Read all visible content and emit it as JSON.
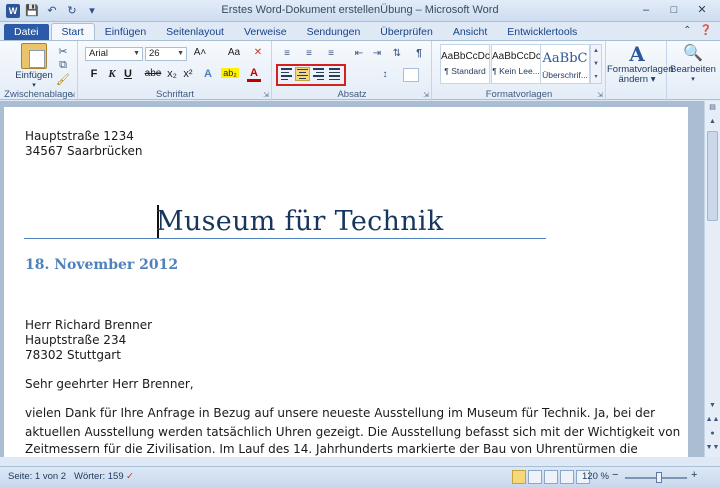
{
  "window": {
    "title": "Erstes Word-Dokument erstellenÜbung – Microsoft Word",
    "app_icon": "W",
    "controls": [
      "–",
      "□",
      "✕"
    ]
  },
  "qat": [
    "save-icon",
    "undo-icon",
    "redo-icon",
    "customize-icon"
  ],
  "tabs": [
    {
      "label": "Datei",
      "kind": "file"
    },
    {
      "label": "Start",
      "kind": "active"
    },
    {
      "label": "Einfügen"
    },
    {
      "label": "Seitenlayout"
    },
    {
      "label": "Verweise"
    },
    {
      "label": "Sendungen"
    },
    {
      "label": "Überprüfen"
    },
    {
      "label": "Ansicht"
    },
    {
      "label": "Entwicklertools"
    }
  ],
  "ribbon": {
    "clipboard": {
      "label": "Zwischenablage",
      "paste_label": "Einfügen"
    },
    "font": {
      "label": "Schriftart",
      "font_name": "Arial",
      "font_size": "26",
      "grow": "A˄",
      "aa": "Aa",
      "bold": "F",
      "italic": "K",
      "underline": "U",
      "strike": "abe",
      "sub": "x₂",
      "sup": "x²",
      "effects": "A",
      "highlight": "ab₂",
      "color": "A"
    },
    "paragraph": {
      "label": "Absatz",
      "pilcrow": "¶"
    },
    "styles": {
      "label": "Formatvorlagen",
      "items": [
        {
          "sample": "AaBbCcDc",
          "name": "¶ Standard"
        },
        {
          "sample": "AaBbCcDc",
          "name": "¶ Kein Lee..."
        },
        {
          "sample": "AaBbC",
          "name": "Überschrif..."
        }
      ],
      "change_label_1": "Formatvorlagen",
      "change_label_2": "ändern ▾"
    },
    "editing": {
      "label": "Bearbeiten"
    }
  },
  "document": {
    "address_line1": "Hauptstraße 1234",
    "address_line2": "34567 Saarbrücken",
    "title": "Museum für Technik",
    "date": "18. November 2012",
    "recipient_name": "Herr Richard Brenner",
    "recipient_street": "Hauptstraße 234",
    "recipient_city": "78302 Stuttgart",
    "salutation": "Sehr geehrter Herr Brenner,",
    "body_line1": "vielen Dank für Ihre Anfrage in Bezug auf unsere neueste Ausstellung im Museum für Technik. Ja, bei der",
    "body_line2": "aktuellen Ausstellung werden tatsächlich Uhren gezeigt. Die Ausstellung befasst sich mit der Wichtigkeit von",
    "body_line3": "Zeitmessern für die Zivilisation. Im Lauf des 14. Jahrhunderts markierte der Bau von Uhrentürmen die"
  },
  "status": {
    "page": "Seite: 1 von 2",
    "words": "Wörter: 159",
    "zoom": "120 %",
    "zoom_minus": "−",
    "zoom_plus": "+",
    "zoom_level": 0.55
  },
  "colors": {
    "accent": "#2a5aa8",
    "title_color": "#17365d",
    "date_color": "#4f81bd",
    "highlight_box": "#d42020"
  }
}
